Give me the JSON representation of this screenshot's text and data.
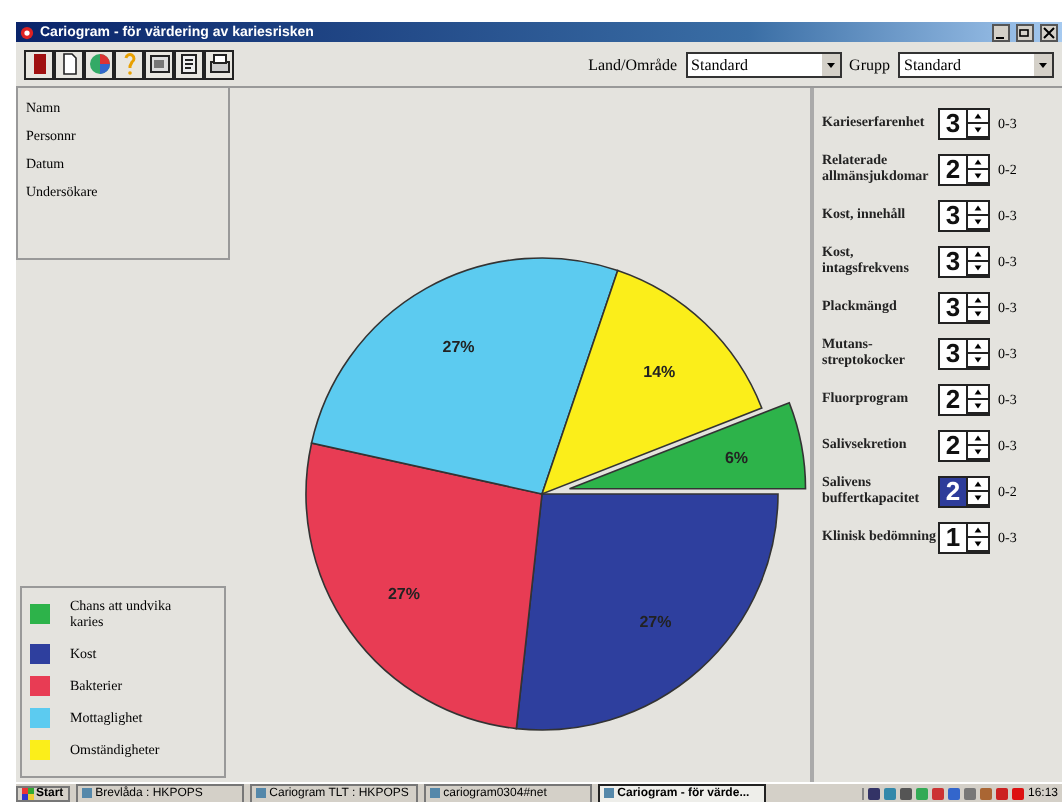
{
  "window": {
    "title": "Cariogram - för värdering av kariesrisken"
  },
  "toolbar": {
    "country_label": "Land/Område",
    "country_value": "Standard",
    "group_label": "Grupp",
    "group_value": "Standard"
  },
  "patient_fields": [
    "Namn",
    "Personnr",
    "Datum",
    "Undersökare"
  ],
  "chart_data": {
    "type": "pie",
    "categories": [
      "Chans att undvika karies",
      "Kost",
      "Bakterier",
      "Mottaglighet",
      "Omständigheter"
    ],
    "values": [
      6,
      27,
      27,
      27,
      14
    ],
    "value_labels": [
      "6%",
      "27%",
      "27%",
      "27%",
      "14%"
    ]
  },
  "legend": [
    {
      "color": "#2db34a",
      "exploded": true
    },
    {
      "color": "#2e3f9e",
      "exploded": false
    },
    {
      "color": "#e83c54",
      "exploded": false
    },
    {
      "color": "#5ccbf0",
      "exploded": false
    },
    {
      "color": "#fbee1a",
      "exploded": false
    }
  ],
  "factors": [
    {
      "label": "Karieserfarenhet",
      "value": "3",
      "range": "0-3",
      "selected": false
    },
    {
      "label": "Relaterade allmänsjukdomar",
      "value": "2",
      "range": "0-2",
      "selected": false
    },
    {
      "label": "Kost, innehåll",
      "value": "3",
      "range": "0-3",
      "selected": false
    },
    {
      "label": "Kost, intagsfrekvens",
      "value": "3",
      "range": "0-3",
      "selected": false
    },
    {
      "label": "Plackmängd",
      "value": "3",
      "range": "0-3",
      "selected": false
    },
    {
      "label": "Mutans-streptokocker",
      "value": "3",
      "range": "0-3",
      "selected": false
    },
    {
      "label": "Fluorprogram",
      "value": "2",
      "range": "0-3",
      "selected": false
    },
    {
      "label": "Salivsekretion",
      "value": "2",
      "range": "0-3",
      "selected": false
    },
    {
      "label": "Salivens buffertkapacitet",
      "value": "2",
      "range": "0-2",
      "selected": true
    },
    {
      "label": "Klinisk bedömning",
      "value": "1",
      "range": "0-3",
      "selected": false
    }
  ],
  "taskbar": {
    "start": "Start",
    "tasks": [
      {
        "label": "Brevlåda : HKPOPS",
        "selected": false
      },
      {
        "label": "Cariogram TLT : HKPOPS",
        "selected": false
      },
      {
        "label": "cariogram0304#net",
        "selected": false
      },
      {
        "label": "Cariogram - för värde...",
        "selected": true
      }
    ],
    "clock": "16:13"
  }
}
